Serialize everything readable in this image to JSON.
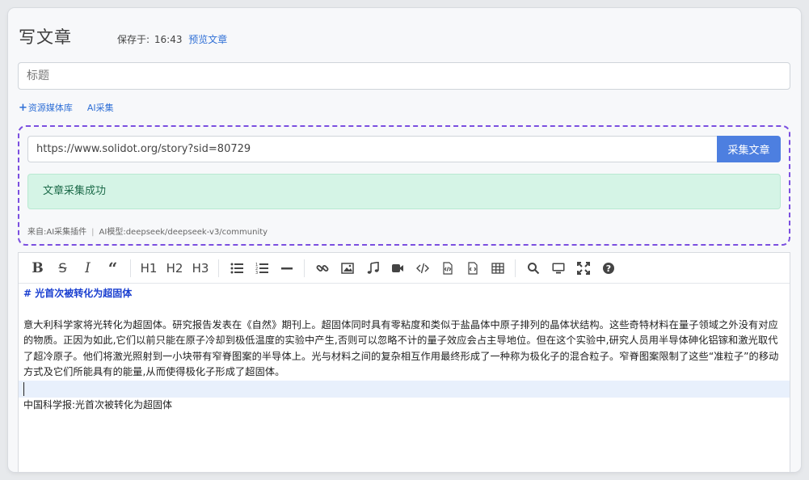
{
  "header": {
    "title": "写文章",
    "saved_label": "保存于:",
    "saved_time": "16:43",
    "preview_link": "预览文章"
  },
  "title_field": {
    "placeholder": "标题",
    "value": ""
  },
  "links": {
    "media_library": "资源媒体库",
    "ai_collect": "AI采集"
  },
  "collect": {
    "url": "https://www.solidot.org/story?sid=80729",
    "button": "采集文章",
    "success_message": "文章采集成功",
    "source_label": "来自:AI采集插件",
    "model_label": "AI模型:deepseek/deepseek-v3/community"
  },
  "toolbar": {
    "items": [
      "bold-icon",
      "strikethrough-icon",
      "italic-icon",
      "quote-icon",
      "h1",
      "h2",
      "h3",
      "unordered-list-icon",
      "ordered-list-icon",
      "horizontal-rule-icon",
      "link-icon",
      "image-icon",
      "audio-icon",
      "video-icon",
      "code-icon",
      "code-file-icon",
      "html-file-icon",
      "table-icon",
      "search-icon",
      "preview-icon",
      "fullscreen-icon",
      "help-icon"
    ],
    "h1": "H1",
    "h2": "H2",
    "h3": "H3"
  },
  "editor": {
    "heading": "# 光首次被转化为超固体",
    "paragraph": "意大利科学家将光转化为超固体。研究报告发表在《自然》期刊上。超固体同时具有零粘度和类似于盐晶体中原子排列的晶体状结构。这些奇特材料在量子领域之外没有对应的物质。正因为如此,它们以前只能在原子冷却到极低温度的实验中产生,否则可以忽略不计的量子效应会占主导地位。但在这个实验中,研究人员用半导体砷化铝镓和激光取代了超冷原子。他们将激光照射到一小块带有窄脊图案的半导体上。光与材料之间的复杂相互作用最终形成了一种称为极化子的混合粒子。窄脊图案限制了这些“准粒子”的移动方式及它们所能具有的能量,从而使得极化子形成了超固体。",
    "footer": "中国科学报:光首次被转化为超固体"
  }
}
